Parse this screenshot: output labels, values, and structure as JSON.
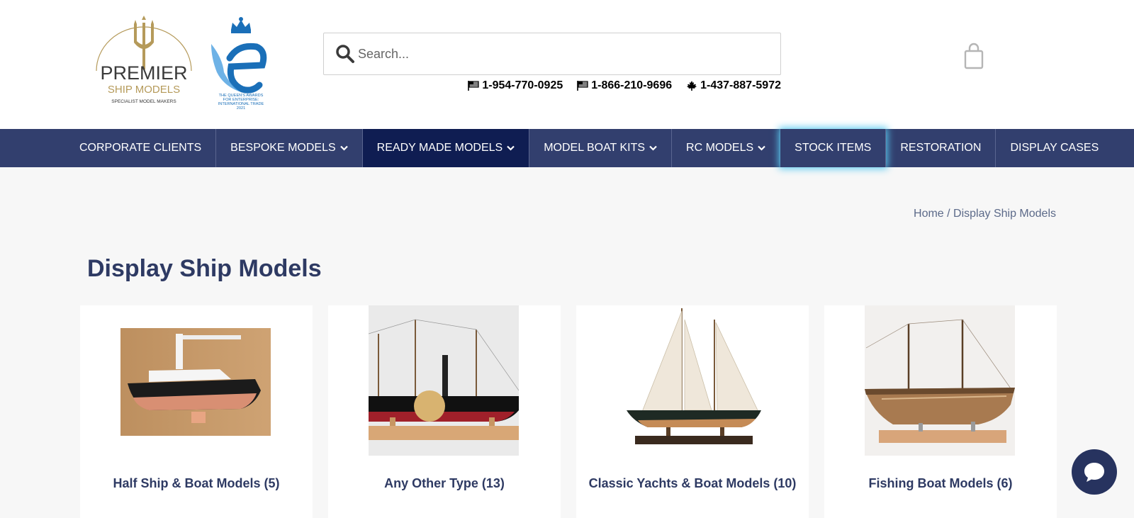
{
  "header": {
    "logo": {
      "brand_line1": "PREMIER",
      "brand_line2": "SHIP MODELS",
      "tagline": "SPECIALIST MODEL MAKERS"
    },
    "award": {
      "line1": "THE QUEEN'S AWARDS",
      "line2": "FOR ENTERPRISE:",
      "line3": "INTERNATIONAL TRADE",
      "year": "2021"
    },
    "search": {
      "placeholder": "Search..."
    },
    "phones": [
      {
        "icon": "us-flag-icon",
        "number": "1-954-770-0925"
      },
      {
        "icon": "us-flag-icon",
        "number": "1-866-210-9696"
      },
      {
        "icon": "maple-leaf-icon",
        "number": "1-437-887-5972"
      }
    ],
    "cart_icon": "shopping-bag-icon"
  },
  "nav": {
    "items": [
      {
        "label": "CORPORATE CLIENTS",
        "dropdown": false
      },
      {
        "label": "BESPOKE MODELS",
        "dropdown": true
      },
      {
        "label": "READY MADE MODELS",
        "dropdown": true,
        "active": true
      },
      {
        "label": "MODEL BOAT KITS",
        "dropdown": true
      },
      {
        "label": "RC MODELS",
        "dropdown": true
      },
      {
        "label": "STOCK ITEMS",
        "dropdown": false,
        "focused": true
      },
      {
        "label": "RESTORATION",
        "dropdown": false
      },
      {
        "label": "DISPLAY CASES",
        "dropdown": false
      }
    ]
  },
  "breadcrumb": {
    "home": "Home",
    "separator": " / ",
    "current": "Display Ship Models"
  },
  "page": {
    "title": "Display Ship Models"
  },
  "categories": [
    {
      "label": "Half Ship & Boat Models (5)"
    },
    {
      "label": "Any Other Type (13)"
    },
    {
      "label": "Classic Yachts & Boat Models (10)"
    },
    {
      "label": "Fishing Boat Models (6)"
    }
  ],
  "colors": {
    "nav_bg": "#323f6e",
    "nav_active": "#0f1d52",
    "title": "#2e3a63",
    "gold": "#b59a5a"
  },
  "chat": {
    "icon": "chat-bubble-icon"
  }
}
